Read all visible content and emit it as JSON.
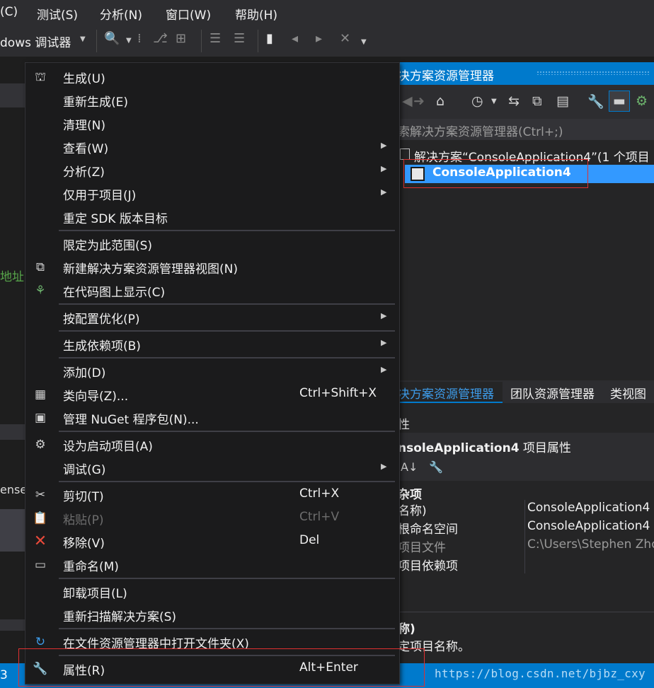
{
  "menubar": {
    "items": [
      "(C)",
      "测试(S)",
      "分析(N)",
      "窗口(W)",
      "帮助(H)"
    ]
  },
  "toolbar": {
    "debugger_label": "dows 调试器"
  },
  "left": {
    "fragment_green": "地址",
    "fragment_ense": "ense"
  },
  "solution_explorer": {
    "title": "决方案资源管理器",
    "search_placeholder": "索解决方案资源管理器(Ctrl+;)",
    "solution_row": "解决方案“ConsoleApplication4”(1 个项目",
    "project_row": "ConsoleApplication4"
  },
  "tabs": {
    "active": "决方案资源管理器",
    "team": "团队资源管理器",
    "class": "类视图"
  },
  "properties": {
    "panel_title": "性",
    "header_name": "nsoleApplication4",
    "header_suffix": " 项目属性",
    "category": "杂项",
    "rows": [
      {
        "key": "名称)",
        "value": "ConsoleApplication4"
      },
      {
        "key": "根命名空间",
        "value": "ConsoleApplication4"
      },
      {
        "key": "项目文件",
        "value": "C:\\Users\\Stephen Zho"
      },
      {
        "key": "项目依赖项",
        "value": ""
      }
    ],
    "desc_title": "称)",
    "desc_text": "定项目名称。"
  },
  "statusbar": {
    "left": "3",
    "watermark": "https://blog.csdn.net/bjbz_cxy"
  },
  "context_menu": {
    "items": [
      {
        "label": "生成(U)",
        "icon": "build-icon"
      },
      {
        "label": "重新生成(E)"
      },
      {
        "label": "清理(N)"
      },
      {
        "label": "查看(W)",
        "submenu": true
      },
      {
        "label": "分析(Z)",
        "submenu": true
      },
      {
        "label": "仅用于项目(J)",
        "submenu": true
      },
      {
        "label": "重定 SDK 版本目标"
      },
      {
        "label": "限定为此范围(S)"
      },
      {
        "label": "新建解决方案资源管理器视图(N)",
        "icon": "new-view-icon"
      },
      {
        "label": "在代码图上显示(C)",
        "icon": "code-map-icon"
      },
      {
        "label": "按配置优化(P)",
        "submenu": true
      },
      {
        "label": "生成依赖项(B)",
        "submenu": true
      },
      {
        "label": "添加(D)",
        "submenu": true
      },
      {
        "label": "类向导(Z)...",
        "shortcut": "Ctrl+Shift+X",
        "icon": "class-wizard-icon"
      },
      {
        "label": "管理 NuGet 程序包(N)...",
        "icon": "nuget-icon"
      },
      {
        "label": "设为启动项目(A)",
        "icon": "gear-icon"
      },
      {
        "label": "调试(G)",
        "submenu": true
      },
      {
        "label": "剪切(T)",
        "shortcut": "Ctrl+X",
        "icon": "scissors-icon"
      },
      {
        "label": "粘贴(P)",
        "shortcut": "Ctrl+V",
        "icon": "paste-icon",
        "disabled": true
      },
      {
        "label": "移除(V)",
        "shortcut": "Del",
        "icon": "remove-icon"
      },
      {
        "label": "重命名(M)",
        "icon": "rename-icon"
      },
      {
        "label": "卸载项目(L)"
      },
      {
        "label": "重新扫描解决方案(S)"
      },
      {
        "label": "在文件资源管理器中打开文件夹(X)",
        "icon": "open-folder-icon"
      },
      {
        "label": "属性(R)",
        "shortcut": "Alt+Enter",
        "icon": "wrench-icon"
      }
    ]
  }
}
